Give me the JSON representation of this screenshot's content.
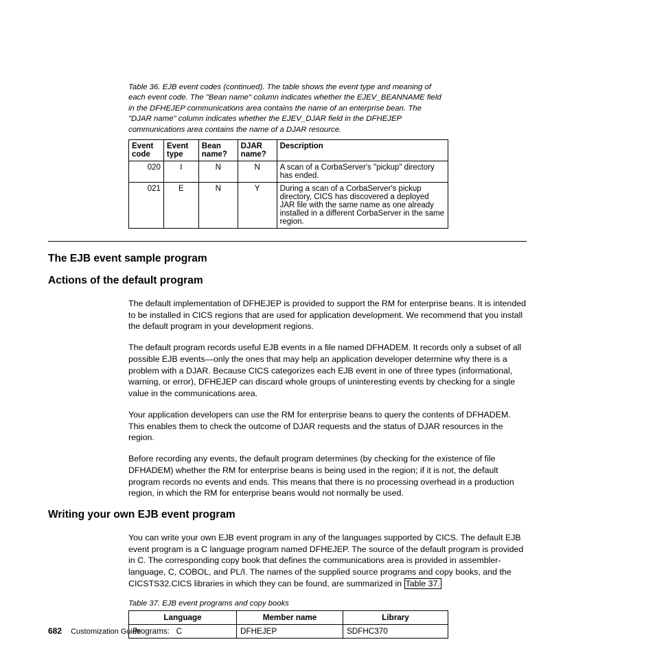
{
  "table36": {
    "caption": "Table 36. EJB event codes  (continued).  The table shows the event type and meaning of each event code. The \"Bean name\" column indicates whether the EJEV_BEANNAME field in the DFHEJEP communications area contains the name of an enterprise bean. The \"DJAR name\" column indicates whether the EJEV_DJAR field in the DFHEJEP communications area contains the name of a DJAR resource.",
    "headers": {
      "event_code": "Event code",
      "event_type": "Event type",
      "bean_name": "Bean name?",
      "djar_name": "DJAR name?",
      "description": "Description"
    },
    "rows": [
      {
        "event_code": "020",
        "event_type": "I",
        "bean_name": "N",
        "djar_name": "N",
        "description": "A scan of a CorbaServer's \"pickup\" directory has ended."
      },
      {
        "event_code": "021",
        "event_type": "E",
        "bean_name": "N",
        "djar_name": "Y",
        "description": "During a scan of a CorbaServer's pickup directory, CICS has discovered a deployed JAR file with the same name as one already installed in a different CorbaServer in the same region."
      }
    ]
  },
  "headings": {
    "h1": "The EJB event sample program",
    "h2": "Actions of the default program",
    "h3": "Writing your own EJB event program"
  },
  "paras": {
    "p1": "The default implementation of DFHEJEP is provided to support the RM for enterprise beans. It is intended to be installed in CICS regions that are used for application development. We recommend that you install the default program in your development regions.",
    "p2": "The default program records useful EJB events in a file named DFHADEM. It records only a subset of all possible EJB events—only the ones that may help an application developer determine why there is a problem with a DJAR. Because CICS categorizes each EJB event in one of three types (informational, warning, or error), DFHEJEP can discard whole groups of uninteresting events by checking for a single value in the communications area.",
    "p3": "Your application developers can use the RM for enterprise beans to query the contents of DFHADEM. This enables them to check the outcome of DJAR requests and the status of DJAR resources in the region.",
    "p4": "Before recording any events, the default program determines (by checking for the existence of file DFHADEM) whether the RM for enterprise beans is being used in the region; if it is not, the default program records no events and ends. This means that there is no processing overhead in a production region, in which the RM for enterprise beans would not normally be used.",
    "p5a": "You can write your own EJB event program in any of the languages supported by CICS. The default EJB event program is a C language program named DFHEJEP. The source of the default program is provided in C. The corresponding copy book that defines the communications area is provided in assembler-language, C, COBOL, and PL/I. The names of the supplied source programs and copy books, and the CICSTS32.CICS libraries in which they can be found, are summarized in ",
    "p5ref": "Table 37.",
    "p5b": ""
  },
  "table37": {
    "caption": "Table 37. EJB event programs and copy books",
    "headers": {
      "language": "Language",
      "member": "Member name",
      "library": "Library"
    },
    "rows": [
      {
        "language_label": "Programs:",
        "language_value": "C",
        "member": "DFHEJEP",
        "library": "SDFHC370"
      }
    ]
  },
  "footer": {
    "page": "682",
    "title": "Customization Guide"
  }
}
